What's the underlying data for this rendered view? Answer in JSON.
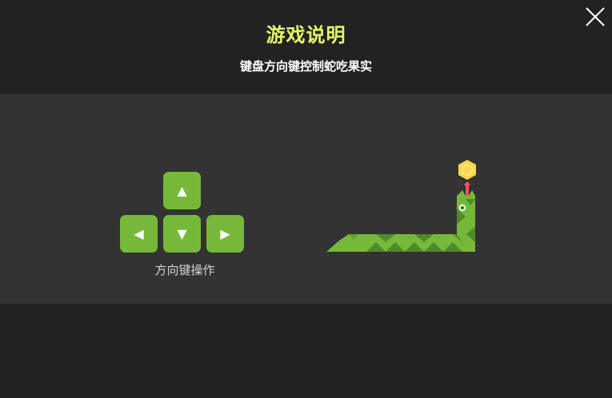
{
  "dialog": {
    "title": "游戏说明",
    "subtitle": "键盘方向键控制蛇吃果实",
    "close_icon": "close-icon"
  },
  "controls": {
    "caption": "方向键操作",
    "keys": [
      {
        "name": "up",
        "glyph": "▲"
      },
      {
        "name": "left",
        "glyph": "◀"
      },
      {
        "name": "down",
        "glyph": "▼"
      },
      {
        "name": "right",
        "glyph": "▶"
      }
    ]
  },
  "illustration": {
    "snake_icon": "snake-icon",
    "fruit_icon": "fruit-icon",
    "colors": {
      "snake_light": "#76b93a",
      "snake_dark": "#4f8a2a",
      "fruit": "#ffd84a",
      "tongue": "#e85a5a"
    }
  },
  "theme": {
    "background": "#222222",
    "band": "#333333",
    "title_color": "#e6f56a",
    "key_color": "#76b93a"
  }
}
